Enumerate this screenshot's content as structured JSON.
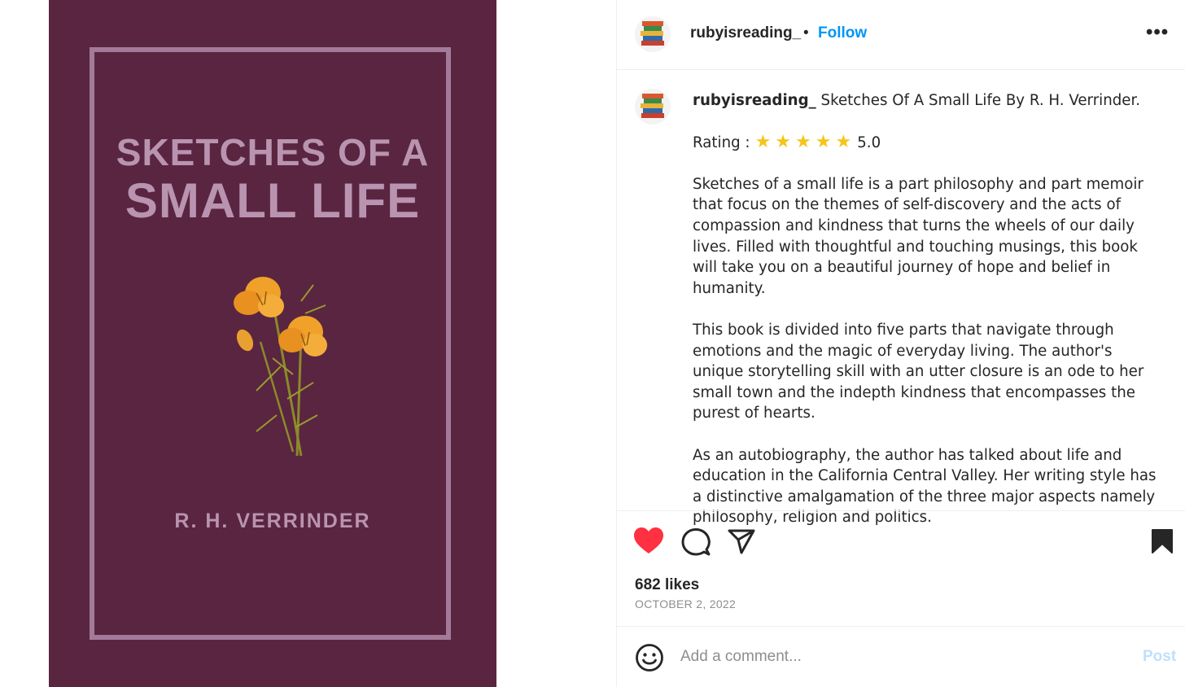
{
  "book_cover": {
    "title_line1": "SKETCHES OF A",
    "title_line2": "SMALL LIFE",
    "author": "R. H. VERRINDER"
  },
  "post_header": {
    "username": "rubyisreading_",
    "separator": "•",
    "follow_label": "Follow",
    "more_label": "•••"
  },
  "caption": {
    "username": "rubyisreading_",
    "title": " Sketches Of A Small Life By R. H. Verrinder.",
    "rating_label": "Rating :",
    "rating_value": "5.0",
    "rating_stars": 5,
    "paragraph1": "Sketches of a small life is a part philosophy and part memoir that focus on the themes of self-discovery and the acts of compassion and kindness that turns the wheels of our daily lives. Filled with thoughtful and touching musings, this book will take you on a beautiful journey of hope and belief in humanity.",
    "paragraph2": "This book is divided into five parts that navigate through emotions and the magic of everyday living. The author's unique storytelling skill with an utter closure is an ode to her small town and the indepth kindness that encompasses the purest of hearts.",
    "paragraph3": "As an autobiography, the author has talked about life and education in the California Central Valley. Her writing style has a distinctive amalgamation of the three major aspects namely philosophy, religion and politics."
  },
  "actions": {
    "likes": "682 likes",
    "date": "OCTOBER 2, 2022"
  },
  "comment": {
    "placeholder": "Add a comment...",
    "post_label": "Post"
  },
  "colors": {
    "cover_bg": "#5a2540",
    "cover_text": "#b994b0",
    "follow_blue": "#0095f6",
    "heart_red": "#ff3040",
    "post_disabled": "#c0dffd"
  },
  "icons": {
    "like": "heart-icon",
    "comment": "comment-bubble-icon",
    "share": "paper-plane-icon",
    "save": "bookmark-icon",
    "emoji": "smiley-icon",
    "more": "more-options-icon"
  }
}
